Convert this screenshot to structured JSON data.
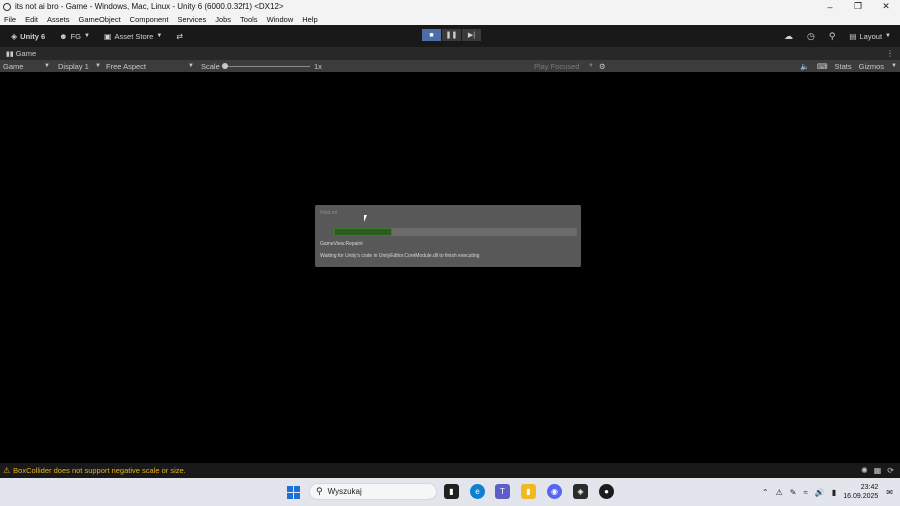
{
  "window": {
    "title": "its not ai bro - Game - Windows, Mac, Linux - Unity 6 (6000.0.32f1) <DX12>"
  },
  "menu": [
    "File",
    "Edit",
    "Assets",
    "GameObject",
    "Component",
    "Services",
    "Jobs",
    "Tools",
    "Window",
    "Help"
  ],
  "toolbar": {
    "unity_label": "Unity 6",
    "account_label": "FG",
    "asset_store_label": "Asset Store",
    "layout_label": "Layout"
  },
  "tab": {
    "label": "Game"
  },
  "gamebar": {
    "mode": "Game",
    "display": "Display 1",
    "aspect": "Free Aspect",
    "scale_label": "Scale",
    "scale_value": "1x",
    "play_focused": "Play Focused",
    "stats": "Stats",
    "gizmos": "Gizmos"
  },
  "progress": {
    "title": "Hold on",
    "fraction": 0.24,
    "info": "GameView.Repaint",
    "detail": "Waiting for Unity's code in UnityEditor.CoreModule.dll to finish executing"
  },
  "status": {
    "message": "BoxCollider does not support negative scale or size."
  },
  "taskbar": {
    "search_placeholder": "Wyszukaj",
    "time": "23:42",
    "date": "16.09.2025"
  },
  "colors": {
    "toolbar_bg": "#191919",
    "gamebar_bg": "#3c3c3c",
    "play_active": "#4a6ea5",
    "progress_fill": "#2d5b1d",
    "warning": "#e8b21e"
  }
}
